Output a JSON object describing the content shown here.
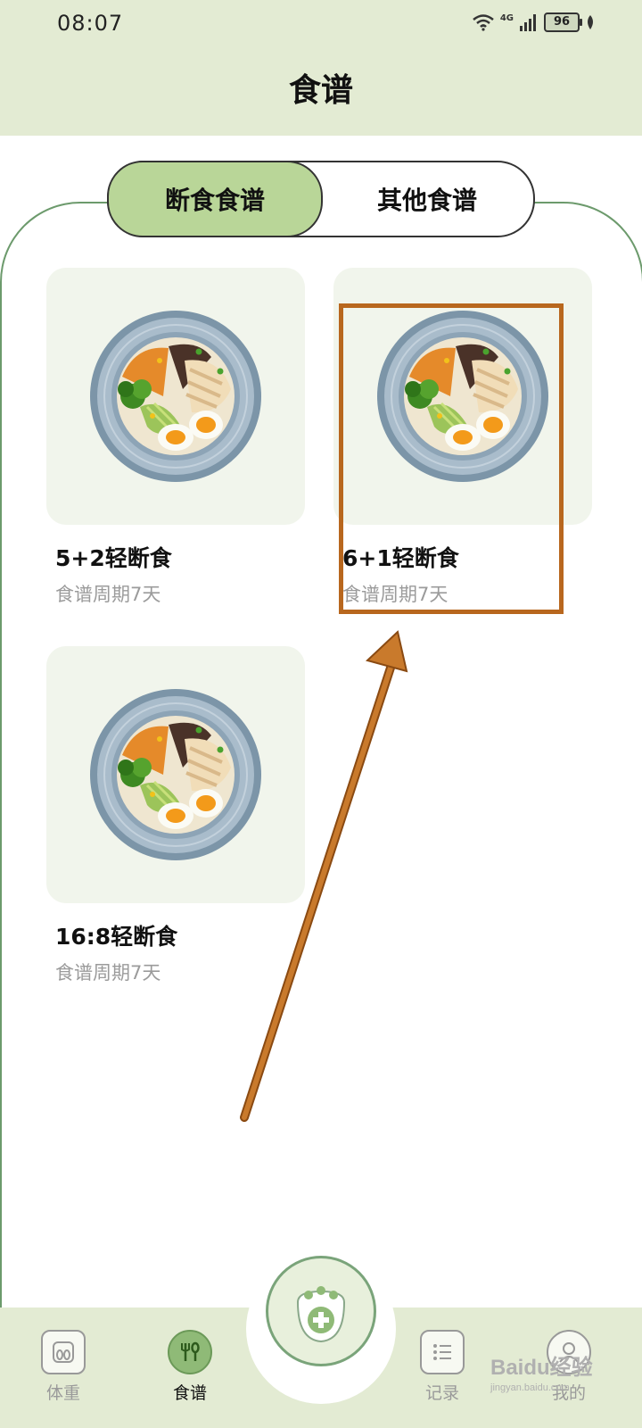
{
  "status_bar": {
    "time": "08:07",
    "network": "4G",
    "battery": "96"
  },
  "header": {
    "title": "食谱"
  },
  "tabs": [
    {
      "label": "断食食谱",
      "active": true
    },
    {
      "label": "其他食谱",
      "active": false
    }
  ],
  "recipes": [
    {
      "title": "5+2轻断食",
      "subtitle": "食谱周期7天"
    },
    {
      "title": "6+1轻断食",
      "subtitle": "食谱周期7天",
      "highlighted": true
    },
    {
      "title": "16:8轻断食",
      "subtitle": "食谱周期7天"
    }
  ],
  "bottom_nav": [
    {
      "label": "体重",
      "icon": "scale-icon"
    },
    {
      "label": "食谱",
      "icon": "fork-spoon-icon",
      "active": true
    },
    {
      "label": "记录",
      "icon": "list-icon"
    },
    {
      "label": "我的",
      "icon": "profile-icon"
    }
  ],
  "fab": {
    "icon": "paw-plus-icon"
  },
  "watermark": {
    "brand": "Baidu经验",
    "url": "jingyan.baidu.com"
  },
  "colors": {
    "header_bg": "#e3ebd3",
    "tab_active": "#b9d698",
    "highlight": "#b8671e",
    "subtitle": "#9b9b9b"
  }
}
